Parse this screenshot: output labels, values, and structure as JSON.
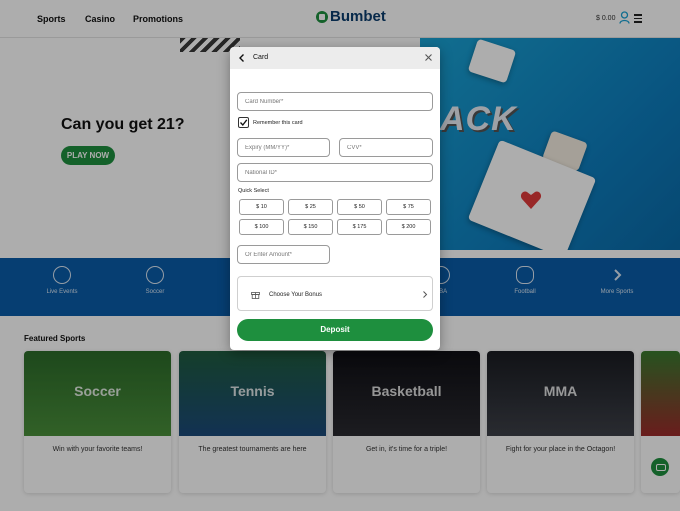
{
  "header": {
    "nav": [
      "Sports",
      "Casino",
      "Promotions"
    ],
    "logo_text": "Bumbet",
    "balance": "$ 0.00"
  },
  "hero": {
    "title": "Can you get 21?",
    "cta": "PLAY NOW",
    "bg_word": "ACK"
  },
  "sports_bar": {
    "items": [
      {
        "label": "Live Events",
        "icon": "antenna-icon"
      },
      {
        "label": "Soccer",
        "icon": "soccer-ball-icon"
      },
      {
        "label": "NBA",
        "icon": "basketball-icon"
      },
      {
        "label": "Football",
        "icon": "football-icon"
      },
      {
        "label": "More Sports",
        "icon": "chevron-right-icon"
      }
    ]
  },
  "featured": {
    "title": "Featured Sports",
    "cards": [
      {
        "name": "Soccer",
        "desc": "Win with your favorite teams!"
      },
      {
        "name": "Tennis",
        "desc": "The greatest tournaments are here"
      },
      {
        "name": "Basketball",
        "desc": "Get in, it's time for a triple!"
      },
      {
        "name": "MMA",
        "desc": "Fight for your place in the Octagon!"
      }
    ]
  },
  "modal": {
    "title": "Card",
    "card_number_placeholder": "Card Number*",
    "remember_label": "Remember this card",
    "remember_checked": true,
    "expiry_placeholder": "Expiry (MM/YY)*",
    "cvv_placeholder": "CVV*",
    "national_id_placeholder": "National ID*",
    "quick_select_label": "Quick Select",
    "amounts": [
      "$ 10",
      "$ 25",
      "$ 50",
      "$ 75",
      "$ 100",
      "$ 150",
      "$ 175",
      "$ 200"
    ],
    "other_amount_placeholder": "Or Enter Amount*",
    "bonus_label": "Choose Your Bonus",
    "deposit_label": "Deposit"
  },
  "colors": {
    "brand_green": "#1e8f3e",
    "brand_blue": "#0a5ca8",
    "logo_navy": "#0b3d6e"
  }
}
